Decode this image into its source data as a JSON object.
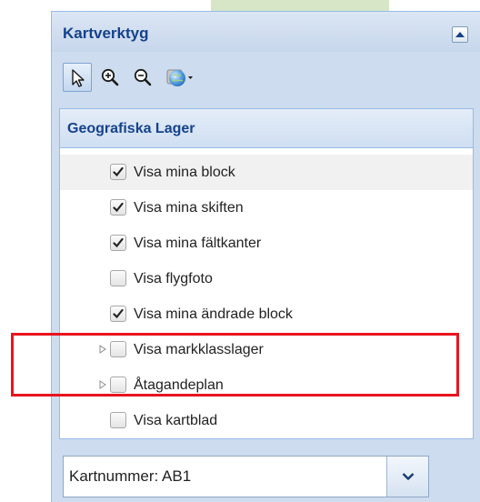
{
  "panel": {
    "title": "Kartverktyg",
    "collapse_icon": "caret-up-icon"
  },
  "toolbar": {
    "tools": [
      {
        "icon": "pointer-icon",
        "active": true
      },
      {
        "icon": "zoom-in-icon",
        "active": false
      },
      {
        "icon": "zoom-out-icon",
        "active": false
      },
      {
        "icon": "globe-dropdown-icon",
        "active": false
      }
    ]
  },
  "layers": {
    "title": "Geografiska Lager",
    "items": [
      {
        "label": "Visa mina block",
        "checked": true,
        "expandable": false
      },
      {
        "label": "Visa mina skiften",
        "checked": true,
        "expandable": false
      },
      {
        "label": "Visa mina fältkanter",
        "checked": true,
        "expandable": false
      },
      {
        "label": "Visa flygfoto",
        "checked": false,
        "expandable": false
      },
      {
        "label": "Visa mina ändrade block",
        "checked": true,
        "expandable": false
      },
      {
        "label": "Visa markklasslager",
        "checked": false,
        "expandable": true
      },
      {
        "label": "Åtagandeplan",
        "checked": false,
        "expandable": true
      },
      {
        "label": "Visa kartblad",
        "checked": false,
        "expandable": false
      }
    ]
  },
  "map_sheet_select": {
    "value": "Kartnummer: AB1"
  },
  "colors": {
    "title": "#15428b",
    "highlight": "#e8141f",
    "panel_bg": "#cddcee"
  }
}
